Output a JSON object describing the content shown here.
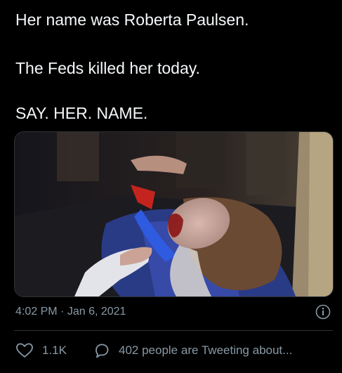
{
  "tweet": {
    "lines": [
      "Her name was Roberta Paulsen.",
      "The Feds killed her today.",
      "SAY. HER. NAME."
    ],
    "time": "4:02 PM",
    "separator": "·",
    "date": "Jan 6, 2021"
  },
  "actions": {
    "like_count": "1.1K",
    "conversation_label": "402 people are Tweeting about..."
  },
  "icons": {
    "info": "info-icon",
    "like": "heart-icon",
    "conversation": "speech-bubble-icon"
  },
  "colors": {
    "background": "#000000",
    "text": "#f5f8fa",
    "secondary_text": "#8899a6",
    "divider": "#2f3336"
  }
}
